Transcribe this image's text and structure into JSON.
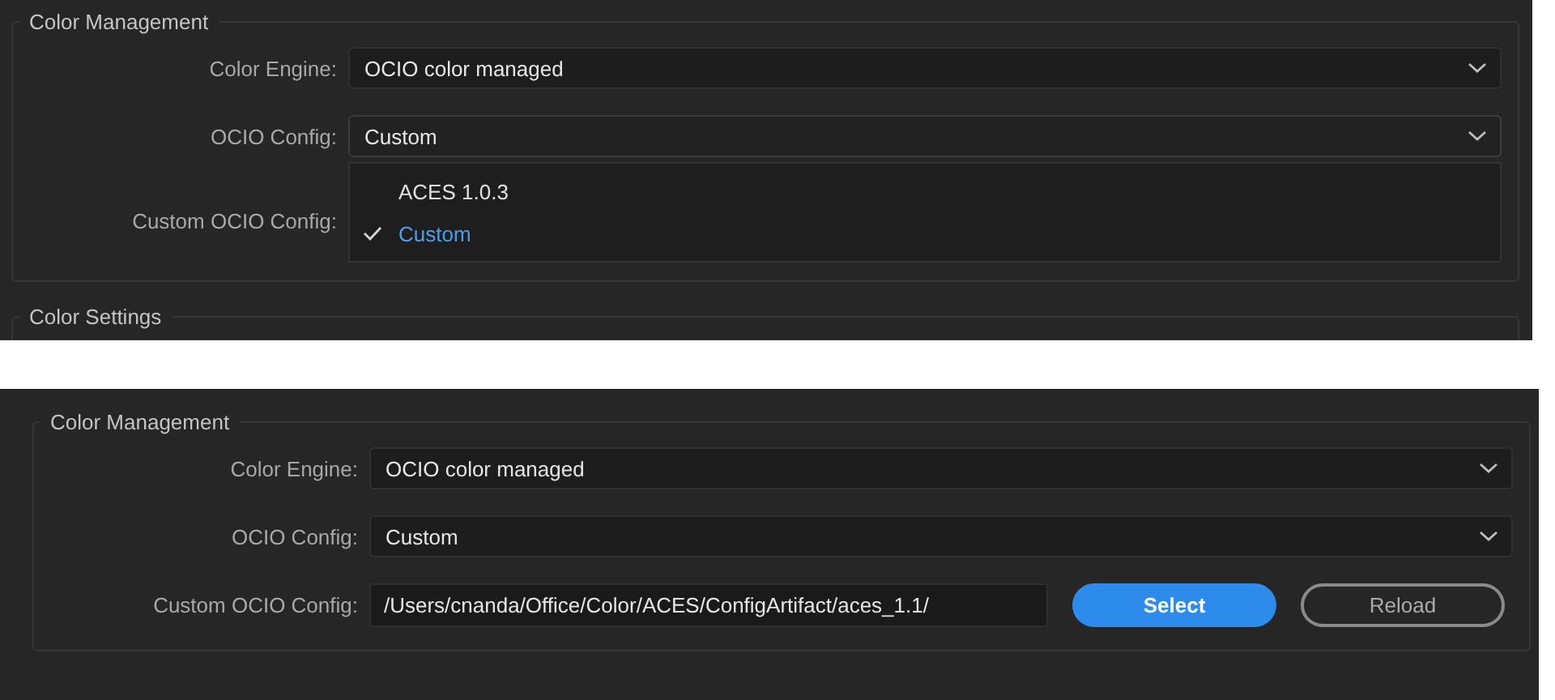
{
  "panels": [
    {
      "groups": [
        {
          "title": "Color Management",
          "rows": [
            {
              "kind": "dropdown",
              "label": "Color Engine:",
              "value": "OCIO color managed"
            },
            {
              "kind": "dropdown",
              "label": "OCIO Config:",
              "value": "Custom",
              "expanded": true,
              "options": [
                {
                  "label": "ACES 1.0.3",
                  "selected": false
                },
                {
                  "label": "Custom",
                  "selected": true
                }
              ]
            },
            {
              "kind": "covered",
              "label": "Custom OCIO Config:"
            }
          ]
        },
        {
          "title": "Color Settings"
        }
      ]
    },
    {
      "groups": [
        {
          "title": "Color Management",
          "rows": [
            {
              "kind": "dropdown",
              "label": "Color Engine:",
              "value": "OCIO color managed"
            },
            {
              "kind": "dropdown",
              "label": "OCIO Config:",
              "value": "Custom",
              "expanded": false
            },
            {
              "kind": "path",
              "label": "Custom OCIO Config:",
              "value": "/Users/cnanda/Office/Color/ACES/ConfigArtifact/aces_1.1/",
              "buttons": [
                {
                  "label": "Select",
                  "kind": "primary"
                },
                {
                  "label": "Reload",
                  "kind": "secondary"
                }
              ]
            }
          ]
        }
      ]
    }
  ]
}
